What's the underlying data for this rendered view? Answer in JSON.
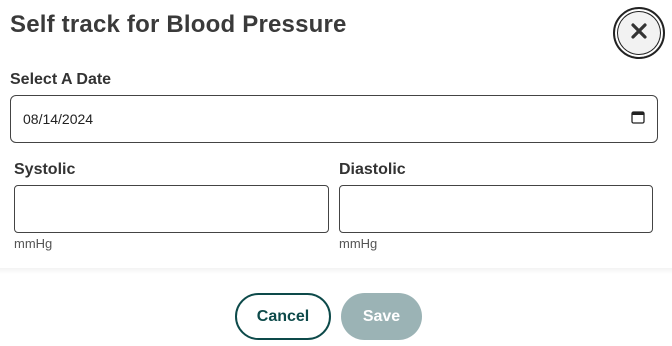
{
  "dialog": {
    "title": "Self track for Blood Pressure",
    "close_icon": "close-icon"
  },
  "form": {
    "date_label": "Select A Date",
    "date_value": "08/14/2024",
    "calendar_icon": "calendar-icon",
    "systolic_label": "Systolic",
    "systolic_value": "",
    "systolic_unit": "mmHg",
    "diastolic_label": "Diastolic",
    "diastolic_value": "",
    "diastolic_unit": "mmHg"
  },
  "actions": {
    "cancel_label": "Cancel",
    "save_label": "Save"
  },
  "colors": {
    "accent": "#0d4a4a",
    "save_disabled": "#9bb3b5"
  }
}
